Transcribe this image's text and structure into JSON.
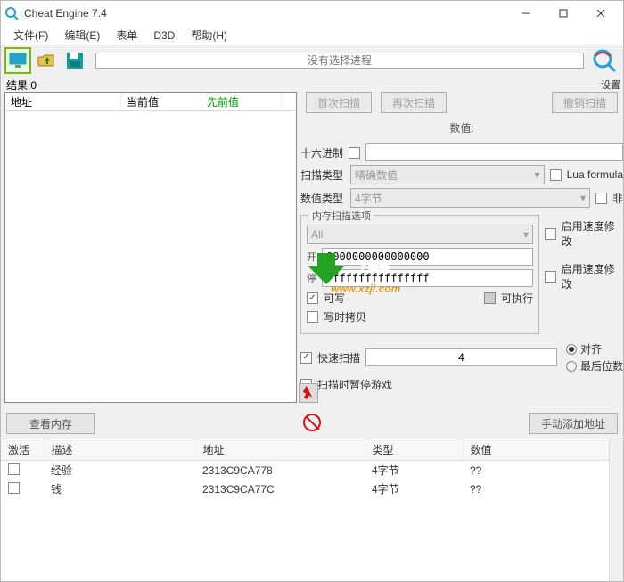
{
  "titlebar": {
    "title": "Cheat Engine 7.4"
  },
  "menu": {
    "file": "文件(F)",
    "edit": "编辑(E)",
    "table": "表单",
    "d3d": "D3D",
    "help": "帮助(H)"
  },
  "toolbar": {
    "no_process": "没有选择进程",
    "settings": "设置"
  },
  "results": {
    "label": "结果:",
    "count": "0"
  },
  "listheaders": {
    "address": "地址",
    "current": "当前值",
    "previous": "先前值"
  },
  "scan": {
    "first": "首次扫描",
    "next": "再次扫描",
    "undo": "撤销扫描",
    "value_label": "数值:",
    "hex": "十六进制",
    "scan_type_label": "扫描类型",
    "scan_type_value": "精确数值",
    "value_type_label": "数值类型",
    "value_type_value": "4字节",
    "lua": "Lua formula",
    "not": "非",
    "memopts_title": "内存扫描选项",
    "region": "All",
    "start_label": "开",
    "start_value": "0000000000000000",
    "stop_label": "停",
    "stop_value": "7fffffffffffffff",
    "writable": "可写",
    "executable": "可执行",
    "cow": "写时拷贝",
    "speedhack1": "启用速度修改",
    "speedhack2": "启用速度修改",
    "fastscan": "快速扫描",
    "fastscan_value": "4",
    "align": "对齐",
    "lastdigits": "最后位数",
    "pause": "扫描时暂停游戏"
  },
  "midbar": {
    "viewmem": "查看内存",
    "addmanual": "手动添加地址"
  },
  "table": {
    "headers": {
      "active": "激活",
      "desc": "描述",
      "addr": "地址",
      "type": "类型",
      "value": "数值"
    },
    "rows": [
      {
        "desc": "经验",
        "addr": "2313C9CA778",
        "type": "4字节",
        "value": "??"
      },
      {
        "desc": "钱",
        "addr": "2313C9CA77C",
        "type": "4字节",
        "value": "??"
      }
    ]
  },
  "watermark": {
    "line1": "下载集",
    "line2": "www.xzji.com"
  }
}
